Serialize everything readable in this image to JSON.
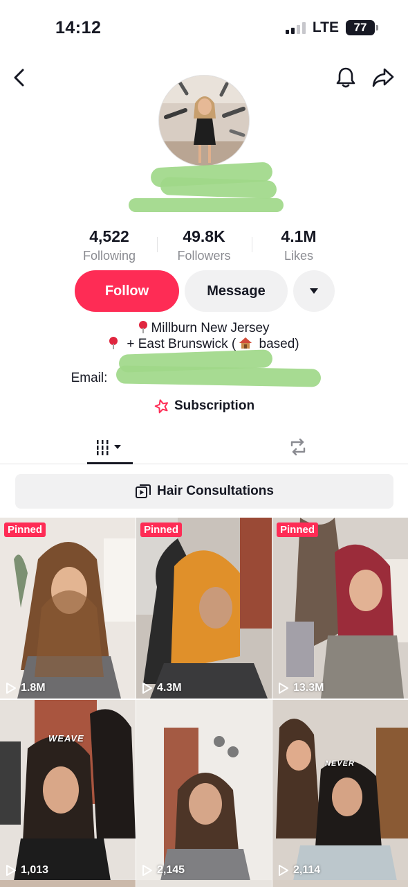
{
  "status_bar": {
    "time": "14:12",
    "network": "LTE",
    "battery": "77"
  },
  "nav": {
    "back_icon": "chevron-left-icon",
    "bell_icon": "bell-icon",
    "share_icon": "share-icon"
  },
  "profile": {
    "stats": [
      {
        "value": "4,522",
        "label": "Following"
      },
      {
        "value": "49.8K",
        "label": "Followers"
      },
      {
        "value": "4.1M",
        "label": "Likes"
      }
    ],
    "follow_label": "Follow",
    "message_label": "Message",
    "bio": {
      "line1": "Millburn New Jersey",
      "line2_prefix": "+ East Brunswick (",
      "line2_suffix": " based)",
      "email_label": "Email:"
    },
    "subscription_label": "Subscription"
  },
  "playlist": {
    "label": "Hair Consultations"
  },
  "videos": [
    {
      "pinned": "Pinned",
      "views": "1.8M"
    },
    {
      "pinned": "Pinned",
      "views": "4.3M"
    },
    {
      "pinned": "Pinned",
      "views": "13.3M"
    },
    {
      "views": "1,013",
      "overlay": "WEAVE"
    },
    {
      "views": "2,145"
    },
    {
      "views": "2,114",
      "overlay": "NEVER"
    }
  ],
  "colors": {
    "accent": "#fe2c55",
    "text": "#161823",
    "muted": "#8a8b91",
    "button_bg": "#f1f1f2"
  }
}
